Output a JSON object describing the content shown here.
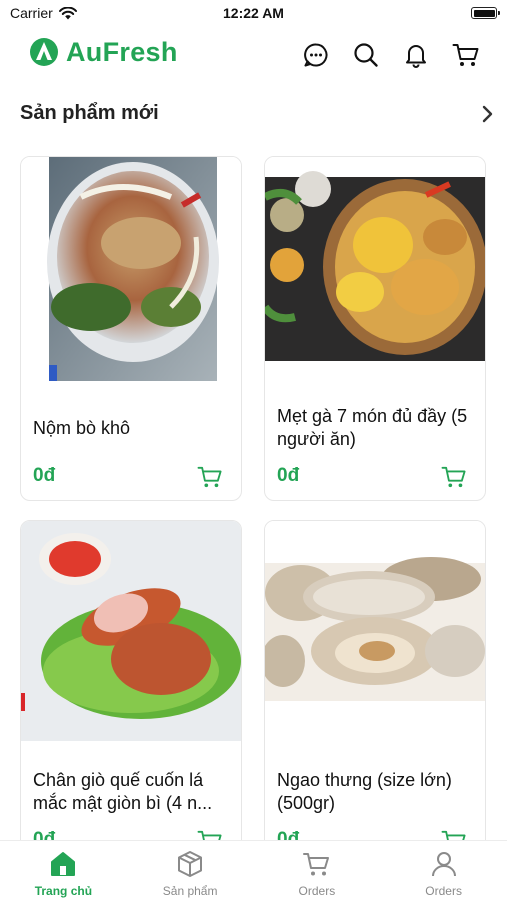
{
  "status_bar": {
    "carrier": "Carrier",
    "time": "12:22 AM"
  },
  "header": {
    "brand": "AuFresh",
    "brand_color": "#23a455",
    "icons": [
      "chat-icon",
      "search-icon",
      "bell-icon",
      "cart-icon"
    ]
  },
  "section": {
    "title": "Sản phẩm mới"
  },
  "products": [
    {
      "name": "Nộm bò khô",
      "price": "0đ",
      "image": "salad-bowl-photo"
    },
    {
      "name": "Mẹt gà 7 món đủ đầy (5 người ăn)",
      "price": "0đ",
      "image": "chicken-platter-photo"
    },
    {
      "name": "Chân giò quế cuốn lá mắc mật giòn bì (4 n...",
      "price": "0đ",
      "image": "roast-pork-roll-photo"
    },
    {
      "name": "Ngao thưng (size lớn) (500gr)",
      "price": "0đ",
      "image": "clams-photo"
    }
  ],
  "bottom_nav": [
    {
      "label": "Trang chủ",
      "icon": "home-icon",
      "active": true
    },
    {
      "label": "Sản phẩm",
      "icon": "box-icon",
      "active": false
    },
    {
      "label": "Orders",
      "icon": "cart-icon",
      "active": false
    },
    {
      "label": "Orders",
      "icon": "user-icon",
      "active": false
    }
  ]
}
